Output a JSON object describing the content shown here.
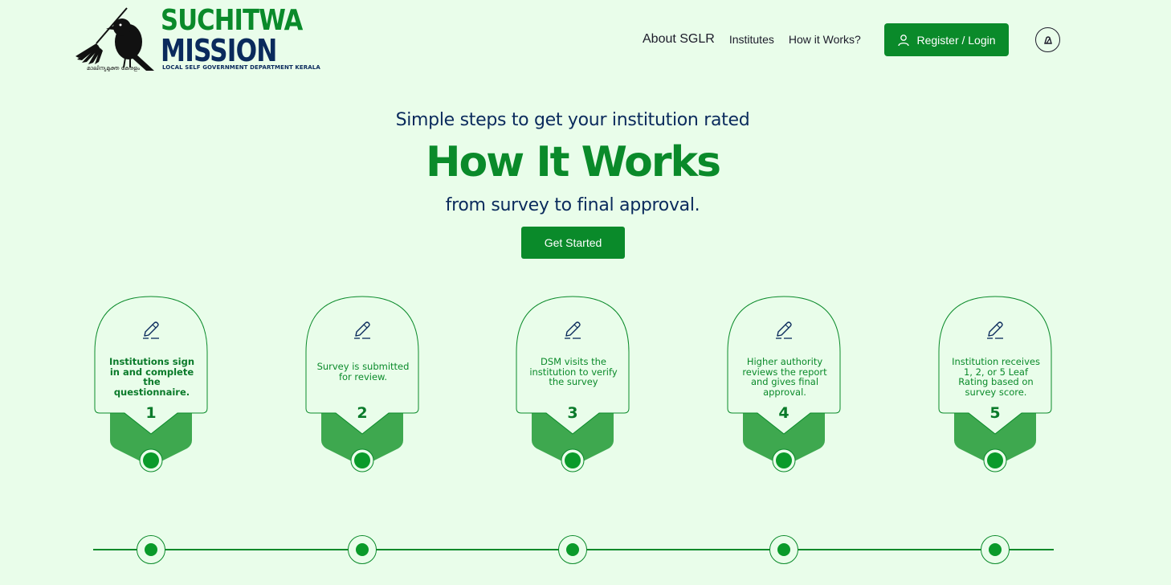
{
  "logo": {
    "line1": "SUCHITWA",
    "line2": "MISSION",
    "subtitle": "LOCAL SELF GOVERNMENT DEPARTMENT KERALA",
    "malayalam": "മാലിന്യമുക്ത കേരളം"
  },
  "nav": {
    "items": [
      "About SGLR",
      "Institutes",
      "How it Works?"
    ],
    "register_label": "Register / Login",
    "theme_toggle_icon": "theme-toggle-icon"
  },
  "hero": {
    "subtitle": "Simple steps to get your institution rated",
    "title": "How It Works",
    "tagline": "from survey to final approval.",
    "cta": "Get Started"
  },
  "steps": [
    {
      "number": "1",
      "text": "Institutions sign in and complete the questionnaire.",
      "icon": "edit-pen-icon"
    },
    {
      "number": "2",
      "text": "Survey is submitted for review.",
      "icon": "edit-pen-icon"
    },
    {
      "number": "3",
      "text": "DSM visits the institution to verify the survey",
      "icon": "edit-pen-icon"
    },
    {
      "number": "4",
      "text": "Higher authority reviews the report and gives final approval.",
      "icon": "edit-pen-icon"
    },
    {
      "number": "5",
      "text": "Institution receives 1, 2, or 5 Leaf Rating based on survey score.",
      "icon": "edit-pen-icon"
    }
  ],
  "colors": {
    "background": "#e9fdea",
    "brand_green": "#0a8a2a",
    "navy": "#0a2a5c",
    "chevron_green": "#3ea84f"
  }
}
